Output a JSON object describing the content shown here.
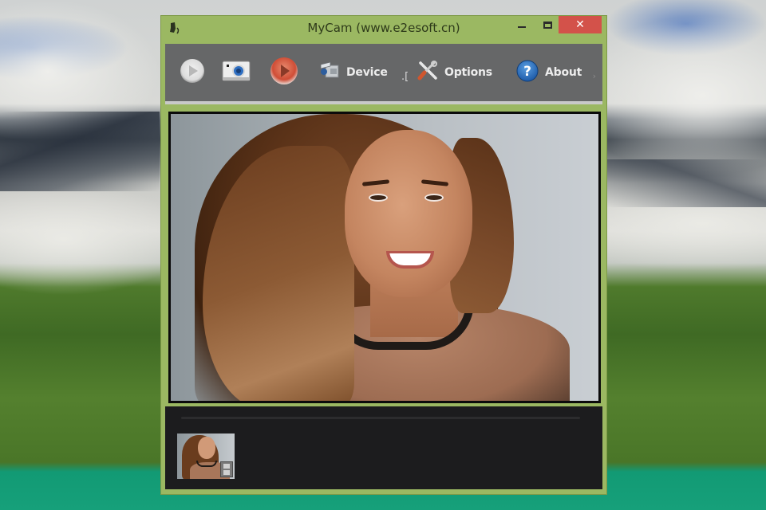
{
  "window": {
    "title": "MyCam (www.e2esoft.cn)",
    "controls": {
      "minimize_icon": "minimize-icon",
      "maximize_icon": "maximize-icon",
      "close_glyph": "✕"
    }
  },
  "toolbar": {
    "items": [
      {
        "id": "play",
        "icon": "play-icon",
        "label": ""
      },
      {
        "id": "snapshot",
        "icon": "camera-icon",
        "label": ""
      },
      {
        "id": "record",
        "icon": "record-icon",
        "label": ""
      },
      {
        "id": "device",
        "icon": "webcam-icon",
        "label": "Device"
      },
      {
        "id": "options",
        "icon": "tools-icon",
        "label": "Options"
      },
      {
        "id": "about",
        "icon": "help-icon",
        "label": "About"
      }
    ],
    "separator_glyph": ".["
  },
  "preview": {
    "description": "Live webcam preview of a smiling woman with long brown hair"
  },
  "gallery": {
    "progress_percent": 0,
    "thumbnails": [
      {
        "type": "video",
        "badge_icon": "film-icon"
      }
    ]
  },
  "colors": {
    "window_frame": "#9bb862",
    "toolbar_bg": "#666768",
    "close_button": "#d3524a",
    "panel_bg": "#1c1c1e"
  }
}
